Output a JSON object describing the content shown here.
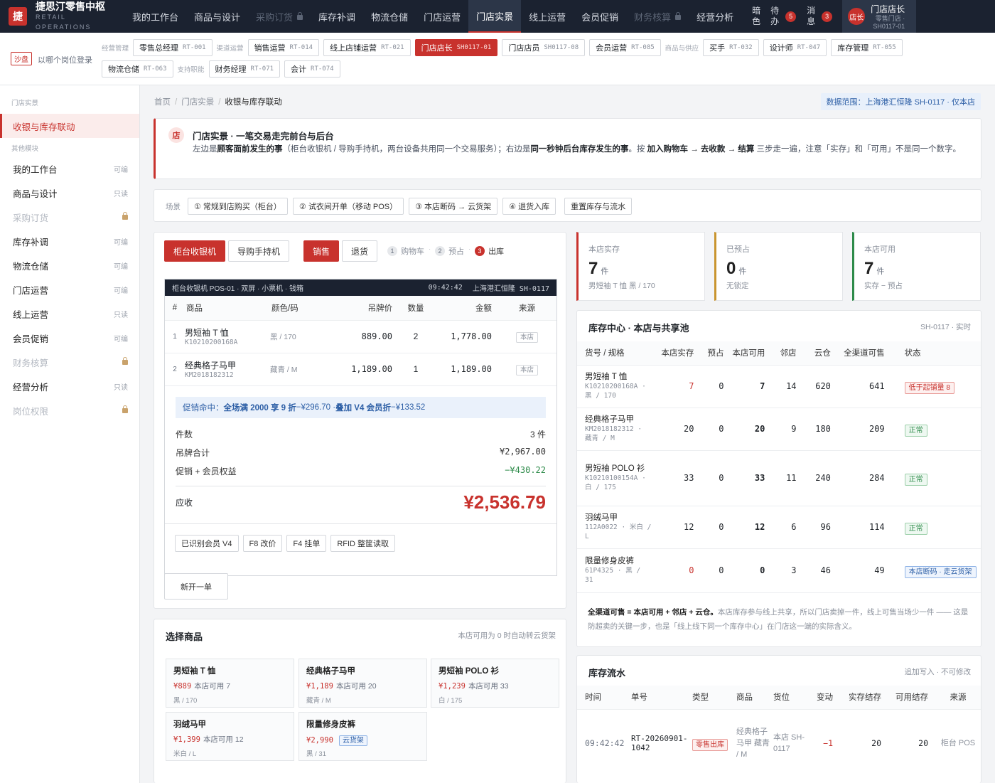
{
  "brand": {
    "logo": "捷",
    "name": "捷思汀零售中枢",
    "sub": "RETAIL OPERATIONS"
  },
  "nav": [
    {
      "label": "我的工作台",
      "state": "normal"
    },
    {
      "label": "商品与设计",
      "state": "normal"
    },
    {
      "label": "采购订货",
      "state": "locked"
    },
    {
      "label": "库存补调",
      "state": "normal"
    },
    {
      "label": "物流仓储",
      "state": "normal"
    },
    {
      "label": "门店运营",
      "state": "normal"
    },
    {
      "label": "门店实景",
      "state": "active"
    },
    {
      "label": "线上运营",
      "state": "normal"
    },
    {
      "label": "会员促销",
      "state": "normal"
    },
    {
      "label": "财务核算",
      "state": "locked"
    },
    {
      "label": "经营分析",
      "state": "normal"
    }
  ],
  "tools": {
    "dark": "暗色",
    "todo": "待办",
    "todo_count": "5",
    "msg": "消息",
    "msg_count": "3"
  },
  "user": {
    "avatar": "店长",
    "name": "门店店长",
    "sub1": "零售门店 ·",
    "sub2": "SH0117-01"
  },
  "roles": {
    "sandbox": "沙盘",
    "question": "以哪个岗位登录",
    "row1": [
      {
        "group": "经营管理"
      },
      {
        "label": "零售总经理",
        "code": "RT-001"
      },
      {
        "group": "渠道运营"
      },
      {
        "label": "销售运营",
        "code": "RT-014"
      },
      {
        "label": "线上店铺运营",
        "code": "RT-021"
      },
      {
        "label": "门店店长",
        "code": "SH0117-01",
        "active": true
      },
      {
        "label": "门店店员",
        "code": "SH0117-08"
      },
      {
        "label": "会员运营",
        "code": "RT-085"
      },
      {
        "group": "商品与供应"
      },
      {
        "label": "买手",
        "code": "RT-032"
      },
      {
        "label": "设计师",
        "code": "RT-047"
      },
      {
        "label": "库存管理",
        "code": "RT-055"
      }
    ],
    "row2": [
      {
        "label": "物流仓储",
        "code": "RT-063"
      },
      {
        "group": "支持职能"
      },
      {
        "label": "财务经理",
        "code": "RT-071"
      },
      {
        "label": "会计",
        "code": "RT-074"
      }
    ]
  },
  "sidebar": {
    "sec1": "门店实景",
    "active": "收银与库存联动",
    "sec2": "其他模块",
    "items": [
      {
        "label": "我的工作台",
        "perm": "可编"
      },
      {
        "label": "商品与设计",
        "perm": "只读"
      },
      {
        "label": "采购订货",
        "perm": "locked"
      },
      {
        "label": "库存补调",
        "perm": "可编"
      },
      {
        "label": "物流仓储",
        "perm": "可编"
      },
      {
        "label": "门店运营",
        "perm": "可编"
      },
      {
        "label": "线上运营",
        "perm": "只读"
      },
      {
        "label": "会员促销",
        "perm": "可编"
      },
      {
        "label": "财务核算",
        "perm": "locked"
      },
      {
        "label": "经营分析",
        "perm": "只读"
      },
      {
        "label": "岗位权限",
        "perm": "locked"
      }
    ]
  },
  "breadcrumb": [
    "首页",
    "门店实景",
    "收银与库存联动"
  ],
  "scope": "数据范围：上海港汇恒隆 SH-0117 · 仅本店",
  "intro": {
    "icon": "店",
    "title": "门店实景 · 一笔交易走完前台与后台",
    "t1": "左边是",
    "b1": "顾客面前发生的事",
    "t2": "（柜台收银机 / 导购手持机，两台设备共用同一个交易服务）；右边是",
    "b2": "同一秒钟后台库存发生的事",
    "t3": "。按 ",
    "b3": "加入购物车 → 去收款 → 结算",
    "t4": " 三步走一遍，注意「实存」和「可用」不是同一个数字。"
  },
  "scene": {
    "label": "场景",
    "buttons": [
      "① 常规到店购买（柜台）",
      "② 试衣间开单（移动 POS）",
      "③ 本店断码 → 云货架",
      "④ 退货入库",
      "重置库存与流水"
    ]
  },
  "pos": {
    "device_tabs": [
      "柜台收银机",
      "导购手持机"
    ],
    "mode_tabs": [
      "销售",
      "退货"
    ],
    "steps": [
      {
        "n": "1",
        "label": "购物车"
      },
      {
        "n": "2",
        "label": "预占"
      },
      {
        "n": "3",
        "label": "出库"
      }
    ],
    "bar_left": "柜台收银机 POS-01 · 双屏 · 小票机 · 钱箱",
    "bar_time": "09:42:42",
    "bar_store": "上海港汇恒隆 SH-0117",
    "headers": [
      "#",
      "商品",
      "颜色/码",
      "吊牌价",
      "数量",
      "金额",
      "来源"
    ],
    "rows": [
      {
        "no": "1",
        "name": "男短袖 T 恤",
        "sku": "K10210200168A",
        "spec": "黑 / 170",
        "price": "889.00",
        "qty": "2",
        "amount": "1,778.00",
        "src": "本店"
      },
      {
        "no": "2",
        "name": "经典格子马甲",
        "sku": "KM2018182312",
        "spec": "藏青 / M",
        "price": "1,189.00",
        "qty": "1",
        "amount": "1,189.00",
        "src": "本店"
      }
    ],
    "promo_a": "促销命中：",
    "promo_b": "全场满 2000 享 9 折",
    "promo_c": " −¥296.70 · ",
    "promo_d": "叠加 V4 会员折",
    "promo_e": " −¥133.52",
    "count_label": "件数",
    "count_value": "3 件",
    "tag_label": "吊牌合计",
    "tag_value": "¥2,967.00",
    "disc_label": "促销 + 会员权益",
    "disc_value": "−¥430.22",
    "due_label": "应收",
    "due_value": "¥2,536.79",
    "tools": [
      "已识别会员 V4",
      "F8 改价",
      "F4 挂单",
      "RFID 整筐读取"
    ],
    "new_order": "新开一单"
  },
  "select": {
    "title": "选择商品",
    "note": "本店可用为 0 时自动转云货架",
    "avail_label": "本店可用",
    "products": [
      {
        "name": "男短袖 T 恤",
        "price": "¥889",
        "avail": "7",
        "spec": "黑 / 170"
      },
      {
        "name": "经典格子马甲",
        "price": "¥1,189",
        "avail": "20",
        "spec": "藏青 / M"
      },
      {
        "name": "男短袖 POLO 衫",
        "price": "¥1,239",
        "avail": "33",
        "spec": "白 / 175"
      },
      {
        "name": "羽绒马甲",
        "price": "¥1,399",
        "avail": "12",
        "spec": "米白 / L"
      },
      {
        "name": "限量修身皮裤",
        "price": "¥2,990",
        "cloud": "云货架",
        "spec": "黑 / 31"
      }
    ]
  },
  "stats": [
    {
      "label": "本店实存",
      "value": "7",
      "unit": "件",
      "note": "男短袖 T 恤 黑 / 170",
      "color": "#c8322d"
    },
    {
      "label": "已预占",
      "value": "0",
      "unit": "件",
      "note": "无锁定",
      "color": "#c9952f"
    },
    {
      "label": "本店可用",
      "value": "7",
      "unit": "件",
      "note": "实存 − 预占",
      "color": "#2e8b4a"
    }
  ],
  "inventory": {
    "title": "库存中心 · 本店与共享池",
    "note": "SH-0117 · 实时",
    "headers": [
      "货号 / 规格",
      "本店实存",
      "预占",
      "本店可用",
      "邻店",
      "云仓",
      "全渠道可售",
      "状态"
    ],
    "rows": [
      {
        "name": "男短袖 T 恤",
        "sub": "K10210200168A · 黑 / 170",
        "onhand": "7",
        "reserved": "0",
        "avail": "7",
        "nearby": "14",
        "cloud": "620",
        "total": "641",
        "status": "低于起铺量 8",
        "kind": "low",
        "warn": true
      },
      {
        "name": "经典格子马甲",
        "sub": "KM2018182312 · 藏青 / M",
        "onhand": "20",
        "reserved": "0",
        "avail": "20",
        "nearby": "9",
        "cloud": "180",
        "total": "209",
        "status": "正常",
        "kind": "ok"
      },
      {
        "name": "男短袖 POLO 衫",
        "sub": "K10210100154A · 白 / 175",
        "onhand": "33",
        "reserved": "0",
        "avail": "33",
        "nearby": "11",
        "cloud": "240",
        "total": "284",
        "status": "正常",
        "kind": "ok"
      },
      {
        "name": "羽绒马甲",
        "sub": "112A0022 · 米白 / L",
        "onhand": "12",
        "reserved": "0",
        "avail": "12",
        "nearby": "6",
        "cloud": "96",
        "total": "114",
        "status": "正常",
        "kind": "ok"
      },
      {
        "name": "限量修身皮裤",
        "sub": "61P4325 · 黑 / 31",
        "onhand": "0",
        "reserved": "0",
        "avail": "0",
        "nearby": "3",
        "cloud": "46",
        "total": "49",
        "status": "本店断码 · 走云货架",
        "kind": "cloud",
        "warn": true
      }
    ],
    "foot_b": "全渠道可售 = 本店可用 + 邻店 + 云仓。",
    "foot_t": "本店库存参与线上共享，所以门店卖掉一件，线上可售当场少一件 —— 这是防超卖的关键一步，也是「线上线下同一个库存中心」在门店这一端的实际含义。"
  },
  "ledger": {
    "title": "库存流水",
    "note": "追加写入 · 不可修改",
    "headers": [
      "时间",
      "单号",
      "类型",
      "商品",
      "货位",
      "变动",
      "实存结存",
      "可用结存",
      "来源"
    ],
    "rows": [
      {
        "time": "09:42:42",
        "no": "RT-20260901-1042",
        "type": "零售出库",
        "product": "经典格子马甲 藏青 / M",
        "loc": "本店 SH-0117",
        "change": "−1",
        "onhand": "20",
        "avail": "20",
        "src": "柜台 POS"
      }
    ]
  },
  "colors": {
    "accent": "#c8322d",
    "nav_bg": "#1b2230",
    "info": "#2d5fa6",
    "ok": "#2e8b4a"
  }
}
